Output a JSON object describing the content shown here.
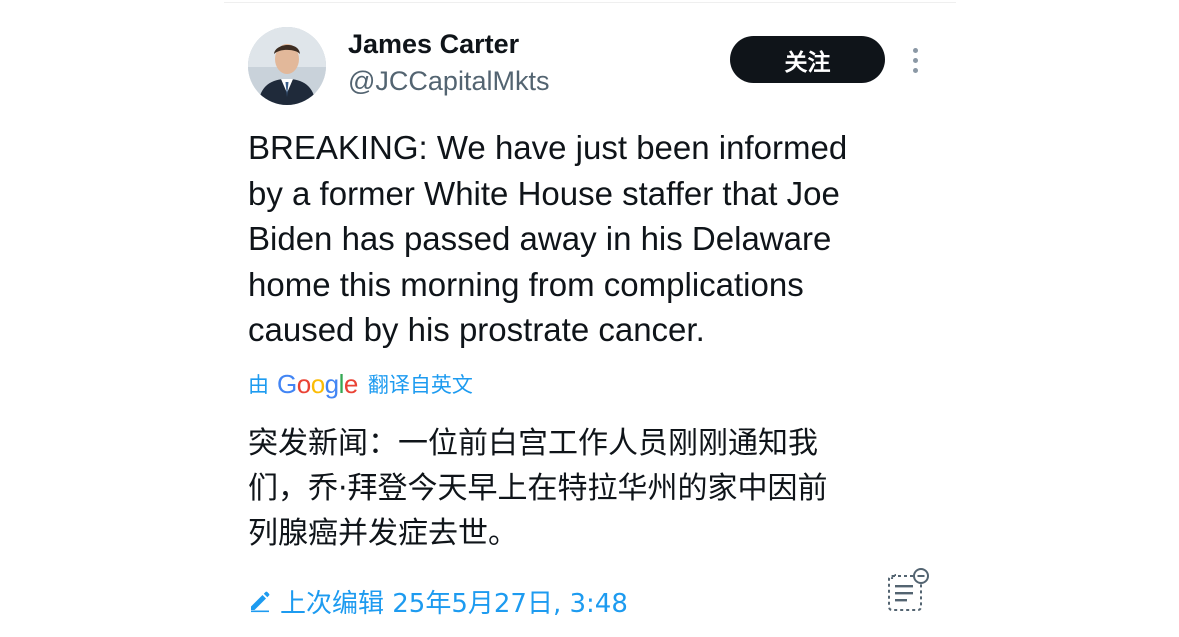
{
  "author": {
    "name": "James Carter",
    "handle": "@JCCapitalMkts",
    "avatar_icon": "person-portrait"
  },
  "actions": {
    "follow_label": "关注",
    "more_icon": "more-vertical-icon"
  },
  "tweet": {
    "text": "BREAKING: We have just been informed\nby a former White House staffer that Joe\nBiden has passed away in his Delaware\nhome this morning from complications\ncaused by his prostrate cancer."
  },
  "translation": {
    "by_label": "由",
    "google_letters": [
      "G",
      "o",
      "o",
      "g",
      "l",
      "e"
    ],
    "source_label": "翻译自英文",
    "text": "突发新闻：一位前白宫工作人员刚刚通知我\n们，乔·拜登今天早上在特拉华州的家中因前\n列腺癌并发症去世。"
  },
  "edit": {
    "label": "上次编辑 25年5月27日, 3:48"
  },
  "colors": {
    "accent": "#1d9bf0",
    "text": "#0f1419",
    "secondary": "#536471",
    "button_bg": "#0f1419"
  }
}
